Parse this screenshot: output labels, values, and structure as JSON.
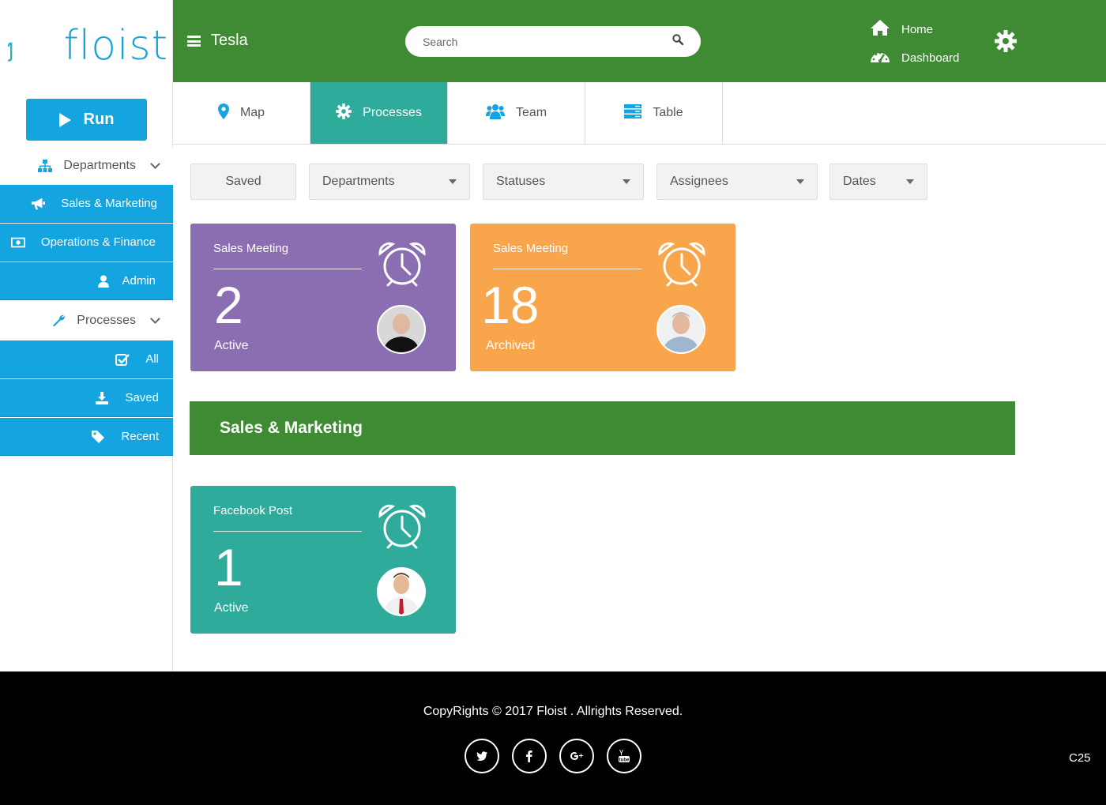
{
  "logo": {
    "text": "floist"
  },
  "sidebar": {
    "run_label": "Run",
    "items": [
      {
        "label": "Departments",
        "icon": "sitemap-icon",
        "type": "group"
      },
      {
        "label": "Sales & Marketing",
        "icon": "megaphone-icon"
      },
      {
        "label": "Operations & Finance",
        "icon": "money-icon"
      },
      {
        "label": "Admin",
        "icon": "user-icon"
      },
      {
        "label": "Processes",
        "icon": "wrench-icon",
        "type": "group"
      },
      {
        "label": "All",
        "icon": "check-square-icon"
      },
      {
        "label": "Saved",
        "icon": "download-icon"
      },
      {
        "label": "Recent",
        "icon": "tag-icon"
      }
    ]
  },
  "header": {
    "brand": "Tesla",
    "search_placeholder": "Search",
    "nav": [
      {
        "label": "Home",
        "icon": "home-icon"
      },
      {
        "label": "Dashboard",
        "icon": "dashboard-icon"
      }
    ],
    "settings_icon": "gear-icon"
  },
  "tabs": [
    {
      "label": "Map",
      "icon": "map-marker-icon",
      "active": false
    },
    {
      "label": "Processes",
      "icon": "gear-icon",
      "active": true
    },
    {
      "label": "Team",
      "icon": "users-icon",
      "active": false
    },
    {
      "label": "Table",
      "icon": "server-icon",
      "active": false
    }
  ],
  "filters": {
    "saved": "Saved",
    "departments": "Departments",
    "statuses": "Statuses",
    "assignees": "Assignees",
    "dates": "Dates"
  },
  "cards": [
    {
      "title": "Sales Meeting",
      "count": "2",
      "status": "Active",
      "color": "#8b6db1"
    },
    {
      "title": "Sales Meeting",
      "count": "18",
      "status": "Archived",
      "color": "#f9a54b"
    },
    {
      "title": "Facebook Post",
      "count": "1",
      "status": "Active",
      "color": "#2eab9a"
    }
  ],
  "section": {
    "title": "Sales & Marketing"
  },
  "footer": {
    "copyright": "CopyRights © 2017 Floist . Allrights Reserved.",
    "socials": [
      {
        "name": "twitter-icon",
        "glyph": "t"
      },
      {
        "name": "facebook-icon",
        "glyph": "f"
      },
      {
        "name": "google-plus-icon",
        "glyph": "g+"
      },
      {
        "name": "youtube-icon",
        "glyph": "▶"
      }
    ],
    "code": "C25"
  },
  "colors": {
    "green": "#3e8b33",
    "blue": "#14a4e0",
    "teal": "#2eab9a",
    "purple": "#8b6db1",
    "orange": "#f9a54b"
  }
}
